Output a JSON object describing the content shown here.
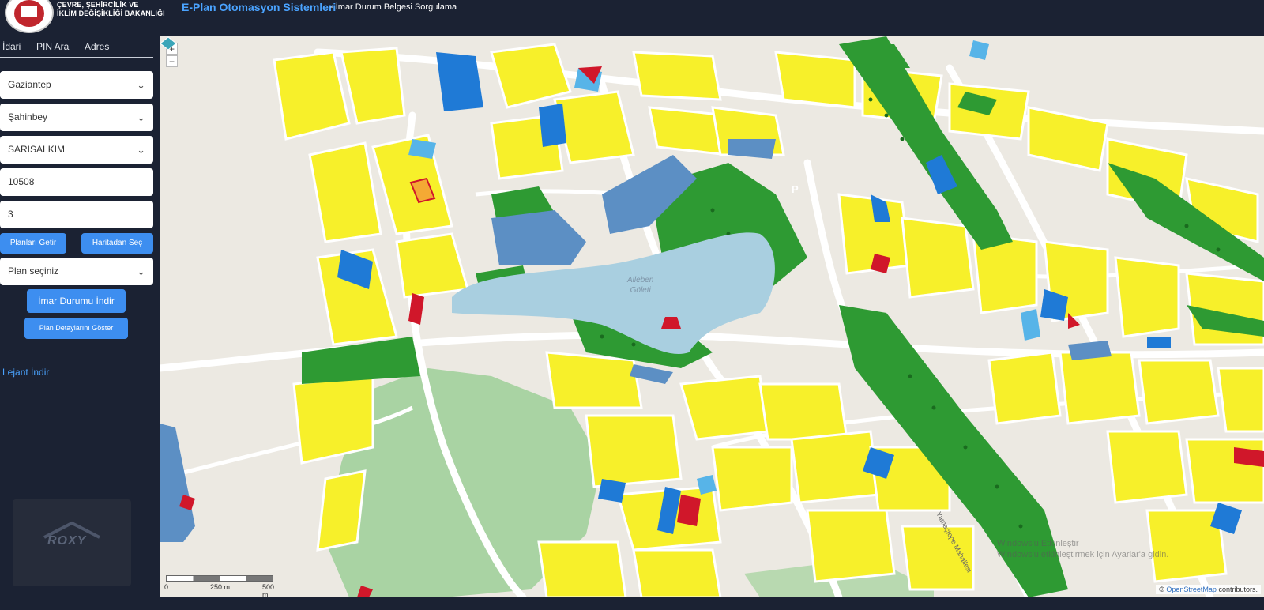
{
  "header": {
    "ministry_line1": "ÇEVRE, ŞEHİRCİLİK VE",
    "ministry_line2": "İKLİM DEĞİŞİKLİĞİ BAKANLIĞI",
    "app_title": "E-Plan Otomasyon Sistemleri",
    "app_subtitle": "- İmar Durum Belgesi Sorgulama"
  },
  "sidebar": {
    "tabs": [
      {
        "label": "İdari"
      },
      {
        "label": "PIN Ara"
      },
      {
        "label": "Adres"
      }
    ],
    "province": "Gaziantep",
    "district": "Şahinbey",
    "neighborhood": "SARISALKIM",
    "block": "10508",
    "parcel": "3",
    "btn_get_plans": "Planları Getir",
    "btn_select_map": "Haritadan Seç",
    "plan_select": "Plan seçiniz",
    "btn_download": "İmar Durumu İndir",
    "btn_details": "Plan Detaylarını Göster",
    "legend_link": "Lejant İndir",
    "watermark_logo": "ROXY"
  },
  "map": {
    "zoom_in": "+",
    "zoom_out": "−",
    "scale_labels": [
      "0",
      "250 m",
      "500 m"
    ],
    "attribution_prefix": "©",
    "attribution_link": "OpenStreetMap",
    "attribution_suffix": "contributors.",
    "lake_label_1": "Alleben",
    "lake_label_2": "Göleti",
    "street_label": "Yamaçtepe Mahallesi",
    "parking_label": "P",
    "windows_line1": "Windows'u Etkinleştir",
    "windows_line2": "Windows'u etkinleştirmek için Ayarlar'a gidin.",
    "colors": {
      "residential": "#f7f02a",
      "green": "#2e9a33",
      "park_light": "#a9d3a3",
      "blue_dark": "#1f7ad6",
      "blue_light": "#57b4e8",
      "slate": "#5c8fc4",
      "red": "#d0172a",
      "water": "#a9cfe0",
      "road": "#ffffff"
    }
  }
}
